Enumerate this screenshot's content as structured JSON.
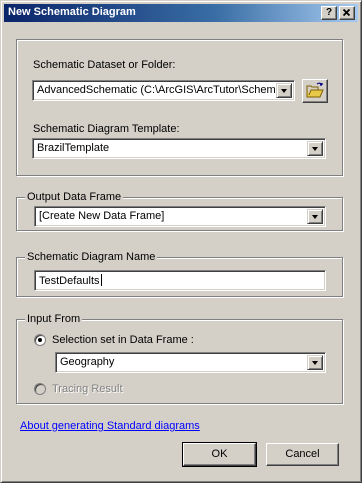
{
  "window": {
    "title": "New Schematic Diagram",
    "help_button": "?",
    "close_button": "X"
  },
  "dataset_group": {
    "dataset_label": "Schematic Dataset or Folder:",
    "dataset_value": "AdvancedSchematic (C:\\ArcGIS\\ArcTutor\\Schemat",
    "folder_button_icon": "open-folder-icon",
    "template_label": "Schematic Diagram Template:",
    "template_value": "BrazilTemplate"
  },
  "output_frame": {
    "legend": "Output Data Frame",
    "value": "[Create New Data Frame]"
  },
  "diagram_name": {
    "legend": "Schematic Diagram Name",
    "value": "TestDefaults"
  },
  "input_from": {
    "legend": "Input From",
    "selection_option": "Selection set in Data Frame :",
    "selection_checked": true,
    "frame_value": "Geography",
    "tracing_option": "Tracing Result",
    "tracing_enabled": false
  },
  "footer": {
    "help_link": "About generating Standard diagrams",
    "ok_label": "OK",
    "cancel_label": "Cancel"
  },
  "colors": {
    "title_start": "#0a246a",
    "title_end": "#a6caf0",
    "face": "#d4d0c8",
    "link": "#0000ff"
  }
}
